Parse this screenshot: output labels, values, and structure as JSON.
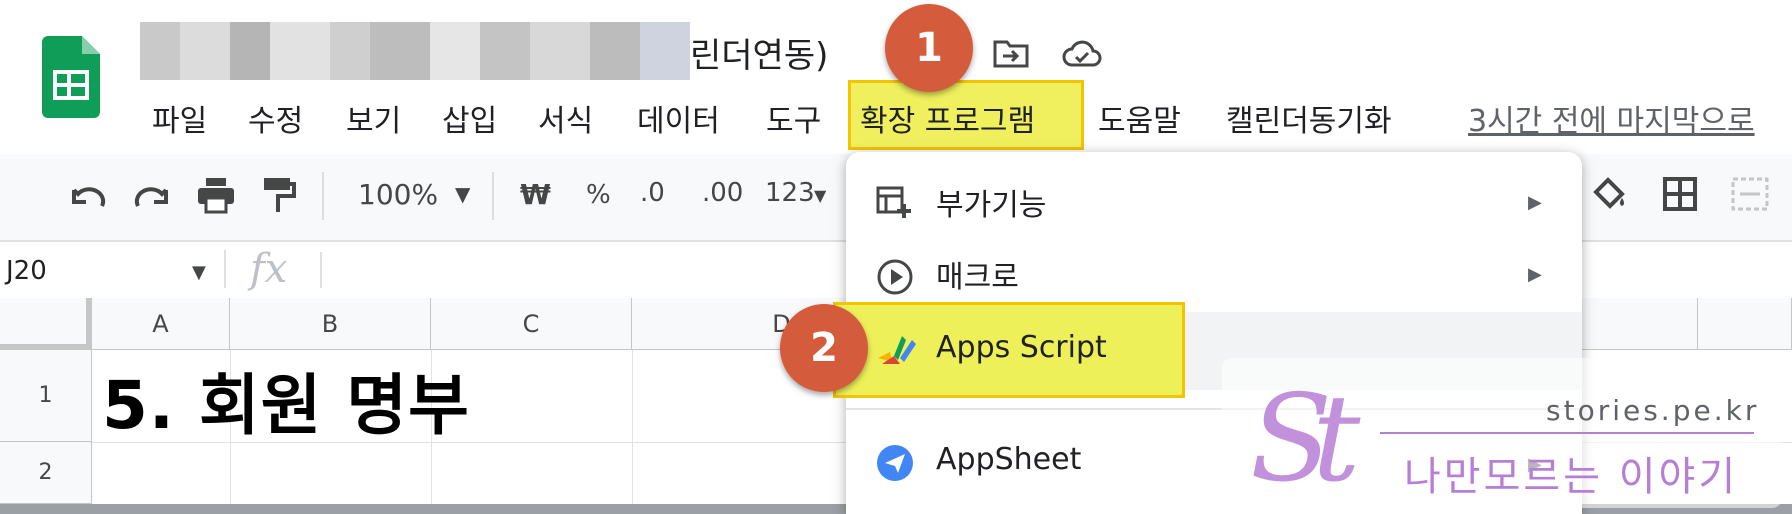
{
  "document": {
    "title_visible_suffix": "린더연동)"
  },
  "menubar": {
    "items": [
      {
        "label": "파일"
      },
      {
        "label": "수정"
      },
      {
        "label": "보기"
      },
      {
        "label": "삽입"
      },
      {
        "label": "서식"
      },
      {
        "label": "데이터"
      },
      {
        "label": "도구"
      },
      {
        "label": "확장 프로그램"
      },
      {
        "label": "도움말"
      },
      {
        "label": "캘린더동기화"
      }
    ],
    "last_edit": "3시간 전에 마지막으로"
  },
  "toolbar": {
    "zoom": "100%",
    "currency": "₩",
    "percent": "%",
    "decimal_decrease": ".0",
    "decimal_increase": ".00",
    "number_format": "123"
  },
  "formula_bar": {
    "cell_ref": "J20",
    "fx_icon": "fx"
  },
  "grid": {
    "columns": [
      "A",
      "B",
      "C",
      "D"
    ],
    "rows": [
      "1",
      "2"
    ],
    "cell_a1": "5. 회원 명부"
  },
  "extensions_menu": {
    "items": [
      {
        "label": "부가기능",
        "icon": "add-on-icon",
        "submenu": true
      },
      {
        "label": "매크로",
        "icon": "play-circle-icon",
        "submenu": true
      },
      {
        "label": "Apps Script",
        "icon": "apps-script-icon",
        "submenu": false
      },
      {
        "label": "AppSheet",
        "icon": "appsheet-icon",
        "submenu": true
      }
    ],
    "submenu_arrow": "▶"
  },
  "annotations": {
    "step1": "1",
    "step2": "2",
    "highlight_color": "#f0f05e",
    "badge_color": "#d45b3b"
  },
  "watermark": {
    "logo": "St",
    "site": "stories.pe.kr",
    "slogan": "나만모르는 이야기"
  },
  "colors": {
    "sheets_green": "#0f9d58",
    "menu_text": "#202124"
  }
}
